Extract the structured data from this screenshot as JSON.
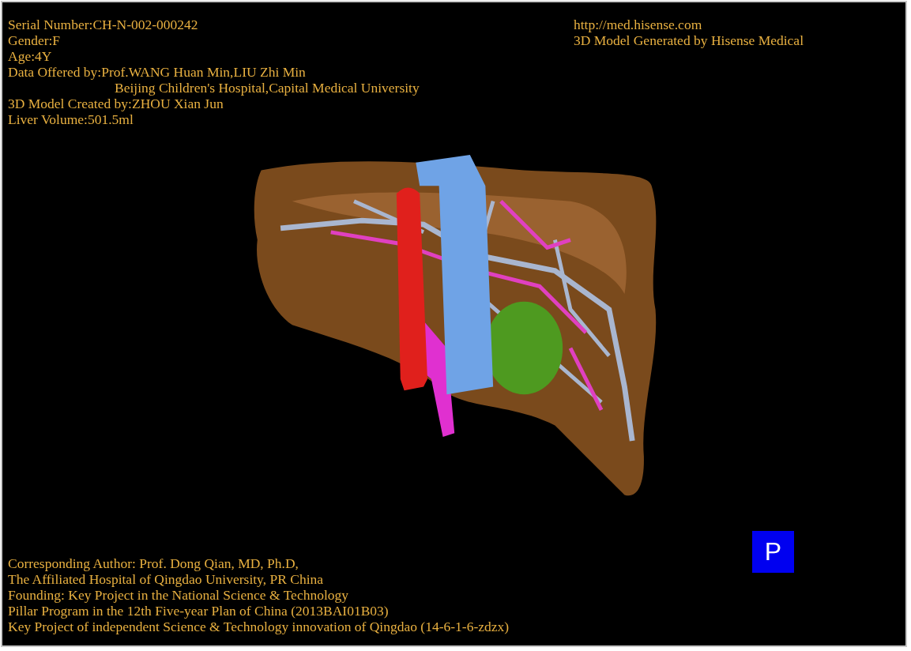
{
  "header_left": [
    {
      "text": "Serial Number:CH-N-002-000242",
      "continued": false
    },
    {
      "text": "Gender:F",
      "continued": false
    },
    {
      "text": "Age:4Y",
      "continued": false
    },
    {
      "text": "Data Offered by:Prof.WANG Huan Min,LIU Zhi Min",
      "continued": false
    },
    {
      "text": "Beijing Children's Hospital,Capital Medical University",
      "continued": true
    },
    {
      "text": "3D Model Created by:ZHOU Xian Jun",
      "continued": false
    },
    {
      "text": "Liver Volume:501.5ml",
      "continued": false
    }
  ],
  "header_right": [
    "http://med.hisense.com",
    "3D Model Generated by Hisense Medical"
  ],
  "footer": [
    "Corresponding Author: Prof. Dong Qian, MD, Ph.D,",
    "The Affiliated Hospital of Qingdao University, PR China",
    "Founding: Key Project in the National Science & Technology",
    "Pillar Program in the 12th Five-year Plan of China (2013BAI01B03)",
    "Key Project of independent Science & Technology innovation of Qingdao (14-6-1-6-zdzx)"
  ],
  "view_button": "P"
}
